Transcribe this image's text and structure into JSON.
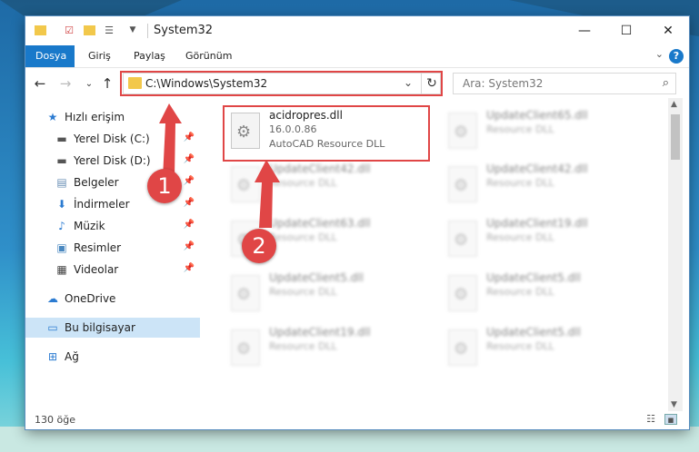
{
  "window": {
    "title": "System32",
    "controls": [
      "minimize-icon",
      "maximize-icon",
      "close-icon"
    ]
  },
  "ribbon": {
    "tabs": [
      "Dosya",
      "Giriş",
      "Paylaş",
      "Görünüm"
    ]
  },
  "navigation": {
    "address": "C:\\Windows\\System32",
    "search_placeholder": "Ara: System32"
  },
  "sidebar": {
    "items": [
      {
        "label": "Hızlı erişim",
        "icon": "star-icon"
      },
      {
        "label": "Yerel Disk (C:)",
        "icon": "drive-icon"
      },
      {
        "label": "Yerel Disk (D:)",
        "icon": "drive-icon"
      },
      {
        "label": "Belgeler",
        "icon": "documents-icon"
      },
      {
        "label": "İndirmeler",
        "icon": "download-icon"
      },
      {
        "label": "Müzik",
        "icon": "music-icon"
      },
      {
        "label": "Resimler",
        "icon": "pictures-icon"
      },
      {
        "label": "Videolar",
        "icon": "video-icon"
      },
      {
        "label": "OneDrive",
        "icon": "cloud-icon"
      },
      {
        "label": "Bu bilgisayar",
        "icon": "computer-icon"
      },
      {
        "label": "Ağ",
        "icon": "network-icon"
      }
    ]
  },
  "files": [
    {
      "name": "acidropres.dll",
      "sub1": "16.0.0.86",
      "sub2": "AutoCAD  Resource DLL"
    },
    {
      "name": "UpdateClient65.dll",
      "sub1": "Resource DLL",
      "sub2": ""
    },
    {
      "name": "UpdateClient42.dll",
      "sub1": "Resource DLL",
      "sub2": ""
    },
    {
      "name": "UpdateClient42.dll",
      "sub1": "Resource DLL",
      "sub2": ""
    },
    {
      "name": "UpdateClient63.dll",
      "sub1": "Resource DLL",
      "sub2": ""
    },
    {
      "name": "UpdateClient19.dll",
      "sub1": "Resource DLL",
      "sub2": ""
    },
    {
      "name": "UpdateClient5.dll",
      "sub1": "Resource DLL",
      "sub2": ""
    },
    {
      "name": "UpdateClient5.dll",
      "sub1": "Resource DLL",
      "sub2": ""
    },
    {
      "name": "UpdateClient19.dll",
      "sub1": "Resource DLL",
      "sub2": ""
    },
    {
      "name": "UpdateClient5.dll",
      "sub1": "Resource DLL",
      "sub2": ""
    }
  ],
  "status": {
    "count": "130 öğe"
  },
  "callouts": [
    "1",
    "2"
  ],
  "colors": {
    "accent": "#1979ca",
    "highlight": "#e04646",
    "selection": "#cce4f7"
  }
}
